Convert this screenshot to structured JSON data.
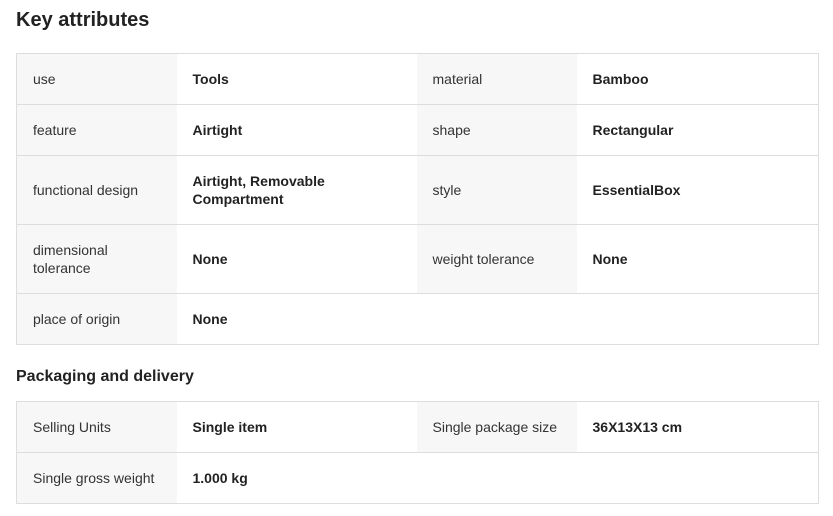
{
  "key_attributes": {
    "title": "Key attributes",
    "rows": [
      {
        "label1": "use",
        "value1": "Tools",
        "label2": "material",
        "value2": "Bamboo"
      },
      {
        "label1": "feature",
        "value1": "Airtight",
        "label2": "shape",
        "value2": "Rectangular"
      },
      {
        "label1": "functional design",
        "value1": "Airtight, Removable Compartment",
        "label2": "style",
        "value2": "EssentialBox"
      },
      {
        "label1": "dimensional tolerance",
        "value1": "None",
        "label2": "weight tolerance",
        "value2": "None"
      },
      {
        "label1": "place of origin",
        "value1": "None"
      }
    ]
  },
  "packaging": {
    "title": "Packaging and delivery",
    "rows": [
      {
        "label1": "Selling Units",
        "value1": "Single item",
        "label2": "Single package size",
        "value2": "36X13X13 cm"
      },
      {
        "label1": "Single gross weight",
        "value1": "1.000 kg"
      }
    ]
  }
}
